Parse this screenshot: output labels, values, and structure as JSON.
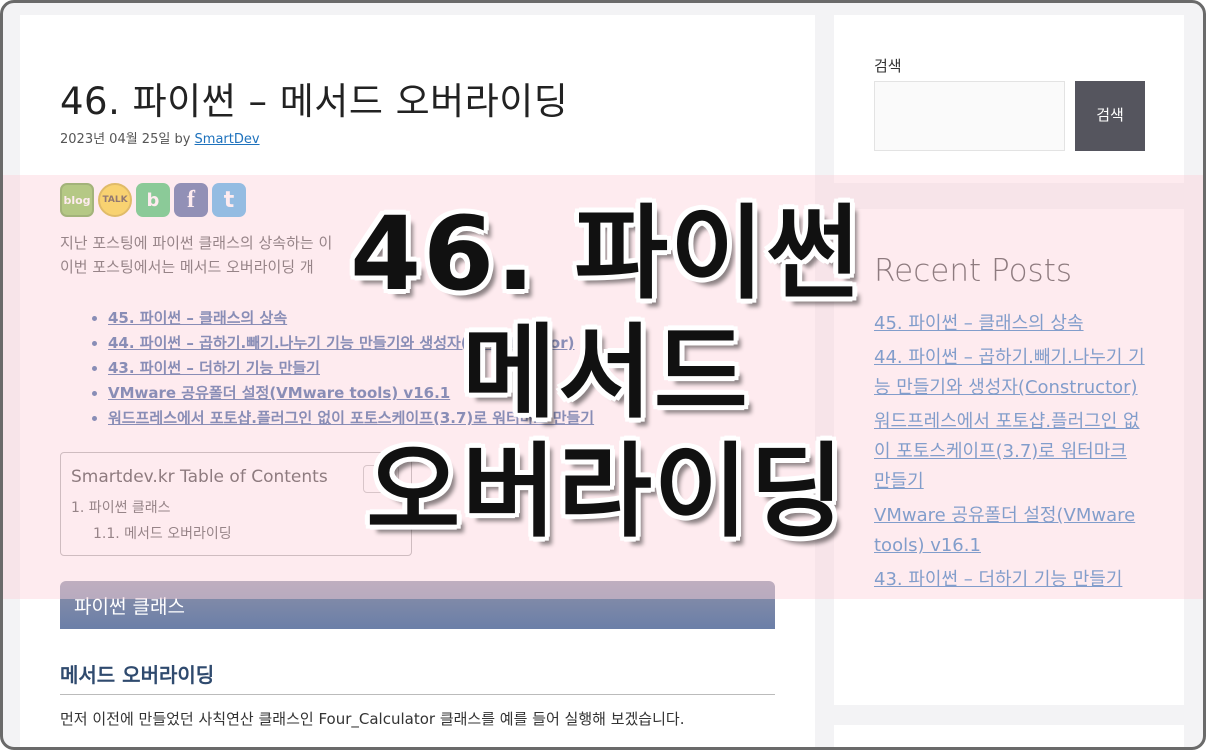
{
  "post": {
    "title": "46. 파이썬 – 메서드 오버라이딩",
    "date": "2023년 04월 25일 by ",
    "author": "SmartDev",
    "intro_line1": "지난 포스팅에 파이썬 클래스의 상속하는 이",
    "intro_line2": "이번 포스팅에서는 메서드 오버라이딩 개"
  },
  "share_icons": [
    "blog",
    "TALK",
    "b",
    "f",
    "t"
  ],
  "related_links": [
    "45. 파이썬 – 클래스의 상속",
    "44. 파이썬 – 곱하기.빼기.나누기 기능 만들기와 생성자(Constructor)",
    "43. 파이썬 – 더하기 기능 만들기",
    "VMware 공유폴더 설정(VMware tools) v16.1",
    "워드프레스에서 포토샵.플러그인 없이 포토스케이프(3.7)로 워터마크 만들기"
  ],
  "toc": {
    "title": "Smartdev.kr Table of Contents",
    "item1": "1. 파이썬 클래스",
    "item2": "1.1. 메서드 오버라이딩"
  },
  "section": {
    "bar_title": "파이썬 클래스",
    "heading": "메서드 오버라이딩",
    "body": "먼저 이전에 만들었던 사칙연산 클래스인 Four_Calculator 클래스를 예를 들어 실행해 보겠습니다."
  },
  "sidebar": {
    "search_label": "검색",
    "search_button": "검색",
    "recent_title": "Recent Posts",
    "recent_posts": [
      "45. 파이썬 – 클래스의 상속",
      "44. 파이썬 – 곱하기.빼기.나누기 기능 만들기와 생성자(Constructor)",
      "워드프레스에서 포토샵.플러그인 없이 포토스케이프(3.7)로 워터마크 만들기",
      "VMware 공유폴더 설정(VMware tools) v16.1",
      "43. 파이썬 – 더하기 기능 만들기"
    ]
  },
  "overlay": {
    "line1": "46. 파이썬",
    "line2": "메서드",
    "line3": "오버라이딩"
  },
  "colors": {
    "link": "#1e72bd",
    "section_bar": "#6b7fa8",
    "search_button": "#55555e",
    "overlay_band": "#fcd2dc"
  }
}
